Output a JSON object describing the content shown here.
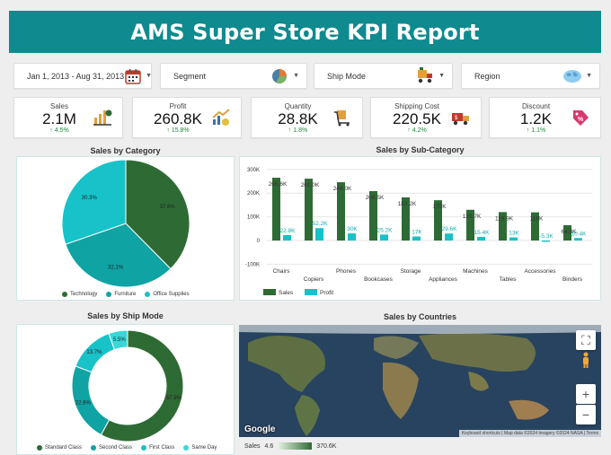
{
  "header": {
    "title": "AMS Super Store KPI Report"
  },
  "filters": {
    "date_range": "Jan 1, 2013 - Aug 31, 2013",
    "segment": "Segment",
    "ship_mode": "Ship Mode",
    "region": "Region",
    "icons": [
      "calendar-icon",
      "pie-chart-icon",
      "delivery-truck-icon",
      "globe-icon"
    ]
  },
  "kpis": [
    {
      "title": "Sales",
      "value": "2.1M",
      "delta": "4.5%",
      "icon": "money-chart-icon"
    },
    {
      "title": "Profit",
      "value": "260.8K",
      "delta": "15.8%",
      "icon": "profit-growth-icon"
    },
    {
      "title": "Quantity",
      "value": "28.8K",
      "delta": "1.8%",
      "icon": "package-cart-icon"
    },
    {
      "title": "Shipping Cost",
      "value": "220.5K",
      "delta": "4.2%",
      "icon": "shipping-truck-icon"
    },
    {
      "title": "Discount",
      "value": "1.2K",
      "delta": "1.1%",
      "icon": "discount-tag-icon"
    }
  ],
  "sales_by_category": {
    "title": "Sales by Category"
  },
  "sales_by_subcategory": {
    "title": "Sales by Sub-Category"
  },
  "sales_by_shipmode": {
    "title": "Sales by Ship Mode"
  },
  "sales_by_countries": {
    "title": "Sales by Countries",
    "legend_label": "Sales",
    "legend_min": "4.6",
    "legend_max": "370.6K",
    "attribution": "Keyboard shortcuts | Map data ©2024 Imagery ©2024 NASA | Terms",
    "logo": "Google",
    "controls": [
      "fullscreen-icon",
      "pegman-icon",
      "zoom-in-icon",
      "zoom-out-icon"
    ]
  },
  "chart_data": [
    {
      "type": "pie",
      "categories": [
        "Technology",
        "Furniture",
        "Office Supplies"
      ],
      "values": [
        37.6,
        32.1,
        30.3
      ],
      "labels": [
        "37.6%",
        "32.1%",
        "30.3%"
      ],
      "colors": [
        "#2e6b34",
        "#0fa3a3",
        "#17c2c8"
      ],
      "legend": "bottom"
    },
    {
      "type": "bar",
      "categories": [
        "Chairs",
        "Copiers",
        "Phones",
        "Bookcases",
        "Storage",
        "Appliances",
        "Machines",
        "Tables",
        "Accessories",
        "Binders"
      ],
      "series": [
        {
          "name": "Sales",
          "values": [
            265000,
            261000,
            246000,
            208500,
            182200,
            170000,
            129700,
            119900,
            119000,
            64800
          ],
          "labels": [
            "265.6K",
            "261.0K",
            "246.0K",
            "208.5K",
            "182.2K",
            "170K",
            "129.7K",
            "119.9K",
            "119K",
            "64.8K"
          ],
          "color": "#2e6b34"
        },
        {
          "name": "Profit",
          "values": [
            22800,
            52200,
            30000,
            25200,
            17000,
            29600,
            15400,
            13000,
            -5300,
            10400
          ],
          "labels": [
            "22.8K",
            "52.2K",
            "30K",
            "25.2K",
            "17K",
            "29.6K",
            "15.4K",
            "13K",
            "-5.3K",
            "10.4K"
          ],
          "color": "#17c2c8"
        }
      ],
      "yticks": [
        "300K",
        "200K",
        "100K",
        "0",
        "-100K"
      ],
      "ylim": [
        -100000,
        300000
      ],
      "legend": "bottom-left"
    },
    {
      "type": "pie",
      "donut": true,
      "categories": [
        "Standard Class",
        "Second Class",
        "First Class",
        "Same Day"
      ],
      "values": [
        57.9,
        22.9,
        13.7,
        5.5
      ],
      "labels": [
        "57.9%",
        "22.9%",
        "13.7%",
        "5.5%"
      ],
      "colors": [
        "#2e6b34",
        "#0fa3a3",
        "#17c2c8",
        "#3ad6d8"
      ],
      "legend": "bottom"
    }
  ]
}
